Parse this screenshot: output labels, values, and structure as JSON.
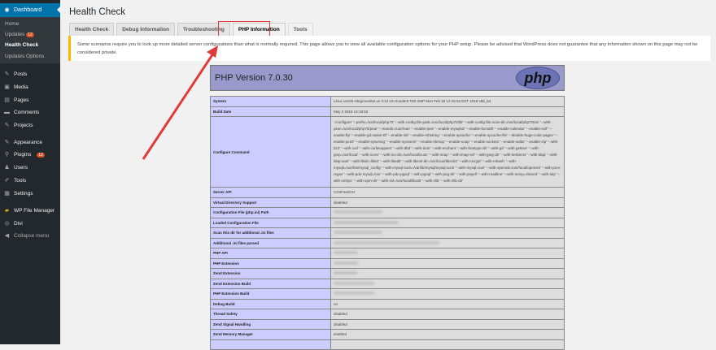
{
  "sidebar": {
    "dashboard": "Dashboard",
    "submenu": [
      {
        "label": "Home"
      },
      {
        "label": "Updates",
        "badge": "12"
      },
      {
        "label": "Health Check"
      },
      {
        "label": "Updates Options"
      }
    ],
    "items": [
      {
        "label": "Posts",
        "icon": "pin-icon"
      },
      {
        "label": "Media",
        "icon": "media-icon"
      },
      {
        "label": "Pages",
        "icon": "pages-icon"
      },
      {
        "label": "Comments",
        "icon": "comment-icon"
      },
      {
        "label": "Projects",
        "icon": "pin-icon"
      },
      {
        "label": "Appearance",
        "icon": "brush-icon"
      },
      {
        "label": "Plugins",
        "icon": "plugin-icon",
        "badge": "12"
      },
      {
        "label": "Users",
        "icon": "users-icon"
      },
      {
        "label": "Tools",
        "icon": "wrench-icon"
      },
      {
        "label": "Settings",
        "icon": "settings-icon"
      },
      {
        "label": "WP File Manager",
        "icon": "folder-icon"
      },
      {
        "label": "Divi",
        "icon": "divi-icon"
      },
      {
        "label": "Collapse menu",
        "icon": "collapse-icon"
      }
    ]
  },
  "page": {
    "title": "Health Check",
    "tabs": [
      "Health Check",
      "Debug Information",
      "Troubleshooting",
      "PHP Information",
      "Tools"
    ],
    "active_tab": "PHP Information",
    "notice": "Some scenarios require you to look up more detailed server configurations than what is normally required. This page allows you to view all available configuration options for your PHP setup. Please be advised that WordPress does not guarantee that any information shown on this page may not be considered private."
  },
  "php": {
    "version": "PHP Version 7.0.30",
    "logo": "php",
    "rows": [
      {
        "k": "System",
        "v": "Linux us100.sitegroundus.us 3.12.18-clouder0 #20 SMP Mon Feb 26 12:15:53 EST 2018 x86_64"
      },
      {
        "k": "Build Date",
        "v": "May 2 2018 14:18:52"
      },
      {
        "k": "Configure Command",
        "v": "'./configure' '--prefix=/usr/local/php70' '--with-config-file-path=/usr/local/php70/lib' '--with-config-file-scan-dir=/usr/local/php70/etc' '--with-pear=/usr/local/php70/pear' '--mandir=/usr/man' '--enable-ipv6' '--enable-mysqlnd' '--enable-bcmath' '--enable-calendar' '--enable-exif' '--enable-ftp' '--enable-gd-native-ttf' '--enable-intl' '--enable-mbstring' '--enable-opcache' '--enable-opcache-file' '--disable-huge-code-pages' '--enable-pcntl' '--enable-sysvmsg' '--enable-sysvsem' '--enable-shmop' '--enable-soap' '--enable-sockets' '--enable-wddx' '--enable-zip' '--with-bz2' '--with-curl' '--with-curlwrappers' '--with-dbd' '--with-dom' '--with-enchant' '--with-freetype-dir' '--with-gd' '--with-gettext' '--with-gmp=/usr/local' '--with-iconv' '--with-icu-dir=/usr/local/icu4c' '--with-imap' '--with-imap-ssl' '--with-jpeg-dir' '--with-kerberos' '--with-ldap' '--with-ldap-sasl' '--with-libdir=lib64' '--with-libedit' '--with-libxml-dir=/usr/local/libxml2' '--with-mcrypt' '--with-mhash' '--with-mysqli=/usr/bin/mysql_config' '--with-mysql-sock=/var/lib/mysql/mysql.sock' '--with-mysql=/usr' '--with-openssl=/usr/local/openssl' '--with-pcre-regex' '--with-pdo-mysql=/usr' '--with-pdo-pgsql' '--with-pgsql' '--with-png-dir' '--with-pspell' '--with-readline' '--with-snmp=shared' '--with-tidy' '--with-xmlrpc' '--with-xpm-dir' '--with-xsl=/usr/local/libxslt' '--with-zlib' '--with-zlib-dir'",
        "long": true
      },
      {
        "k": "Server API",
        "v": "CGI/FastCGI"
      },
      {
        "k": "Virtual Directory Support",
        "v": "disabled"
      },
      {
        "k": "Configuration File (php.ini) Path",
        "blur": 1
      },
      {
        "k": "Loaded Configuration File",
        "blur": 1
      },
      {
        "k": "Scan this dir for additional .ini files",
        "blur": 1
      },
      {
        "k": "Additional .ini files parsed",
        "blur": 1
      },
      {
        "k": "PHP API",
        "blur": 1
      },
      {
        "k": "PHP Extension",
        "blur": 1
      },
      {
        "k": "Zend Extension",
        "blur": 1
      },
      {
        "k": "Zend Extension Build",
        "blur": 1
      },
      {
        "k": "PHP Extension Build",
        "blur": 1
      },
      {
        "k": "Debug Build",
        "v": "no"
      },
      {
        "k": "Thread Safety",
        "v": "disabled"
      },
      {
        "k": "Zend Signal Handling",
        "v": "disabled"
      },
      {
        "k": "Zend Memory Manager",
        "v": "enabled"
      },
      {
        "k": "",
        "v": ""
      }
    ]
  },
  "colors": {
    "accent": "#0073aa",
    "annotation": "#e03a3a",
    "php_header": "#9999cc",
    "php_key": "#ccccff"
  }
}
